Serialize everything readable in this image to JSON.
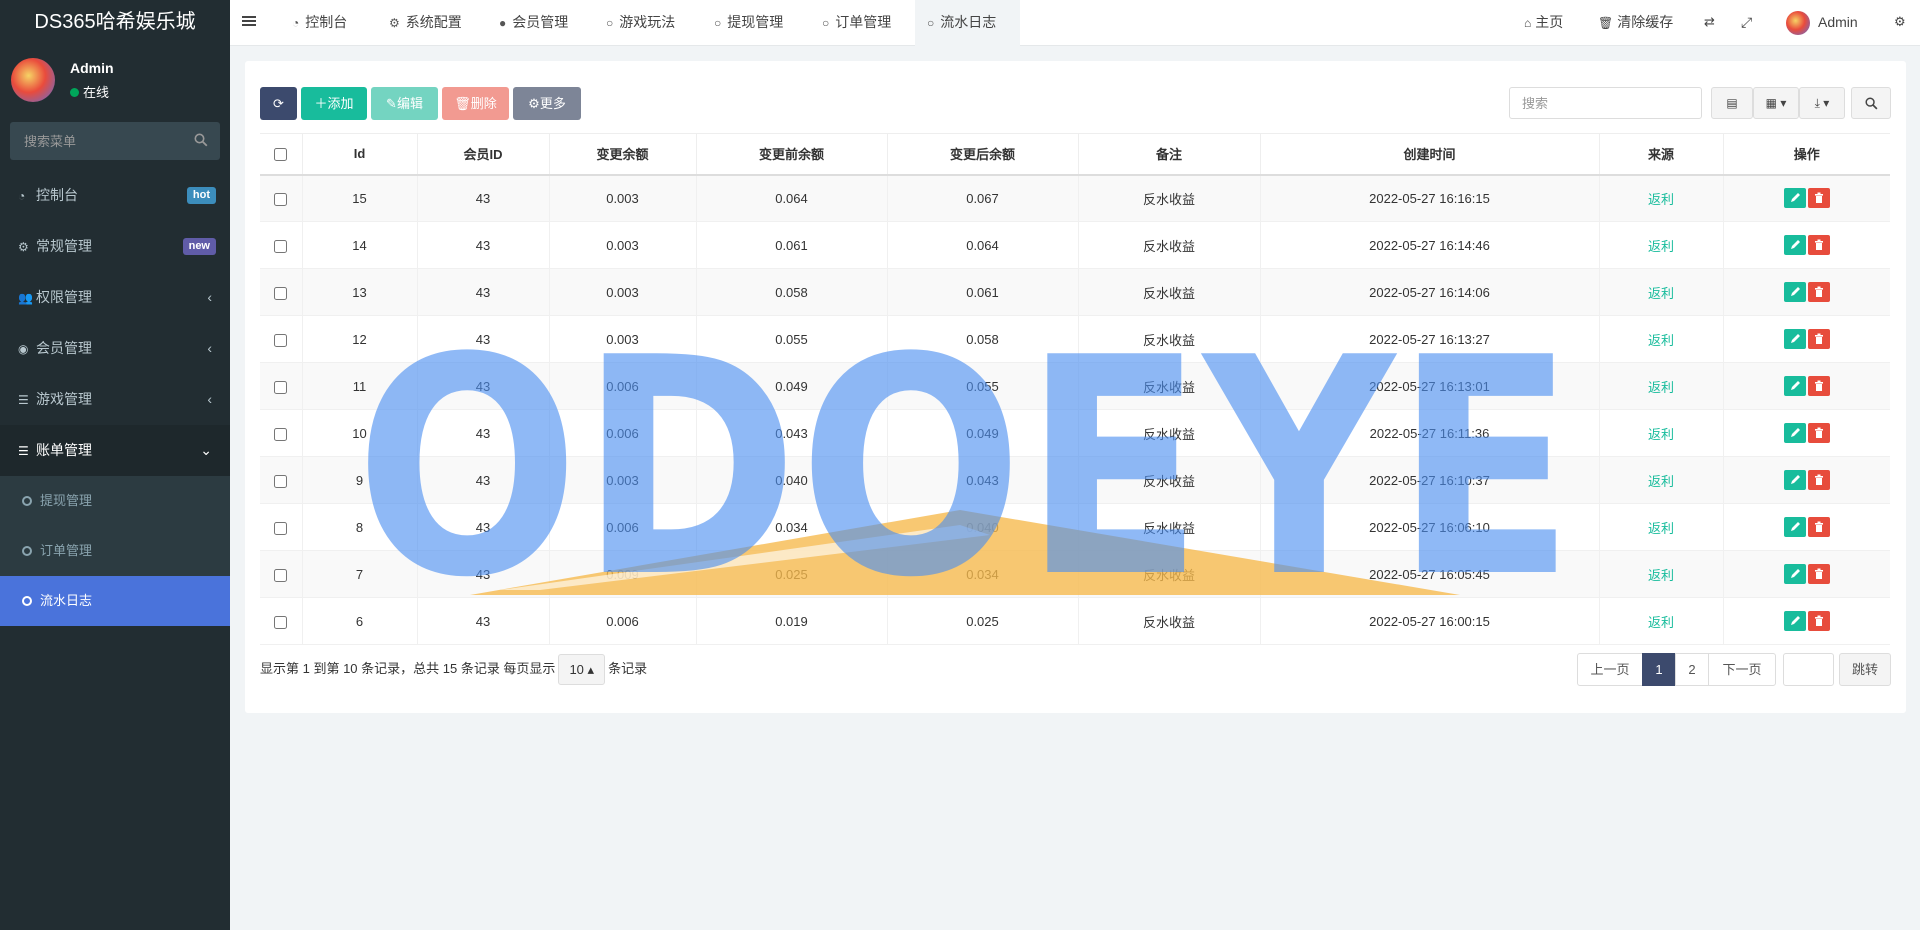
{
  "sidebar": {
    "logo": "DS365哈希娱乐城",
    "user": {
      "name": "Admin",
      "status": "在线"
    },
    "search_placeholder": "搜索菜单",
    "items": [
      {
        "label": "控制台",
        "badge": "hot",
        "badge_color": "#3c8dbc",
        "icon": "dashboard-icon"
      },
      {
        "label": "常规管理",
        "badge": "new",
        "badge_color": "#605ca8",
        "icon": "cogs-icon"
      },
      {
        "label": "权限管理",
        "icon": "users-icon"
      },
      {
        "label": "会员管理",
        "icon": "user-circle-icon"
      },
      {
        "label": "游戏管理",
        "icon": "list-icon"
      },
      {
        "label": "账单管理",
        "icon": "list-icon"
      }
    ],
    "subitems": [
      {
        "label": "提现管理"
      },
      {
        "label": "订单管理"
      },
      {
        "label": "流水日志"
      }
    ]
  },
  "topbar": {
    "tabs": [
      {
        "label": "控制台",
        "icon": "dashboard-icon"
      },
      {
        "label": "系统配置",
        "icon": "gear-icon"
      },
      {
        "label": "会员管理",
        "icon": "user-icon"
      },
      {
        "label": "游戏玩法",
        "icon": "circle-icon"
      },
      {
        "label": "提现管理",
        "icon": "circle-icon"
      },
      {
        "label": "订单管理",
        "icon": "circle-icon"
      },
      {
        "label": "流水日志",
        "icon": "circle-icon"
      }
    ],
    "home": "主页",
    "clear_cache": "清除缓存",
    "admin": "Admin"
  },
  "toolbar": {
    "add": "添加",
    "edit": "编辑",
    "delete": "删除",
    "more": "更多",
    "search_placeholder": "搜索"
  },
  "table": {
    "headers": [
      "Id",
      "会员ID",
      "变更余额",
      "变更前余额",
      "变更后余额",
      "备注",
      "创建时间",
      "来源",
      "操作"
    ],
    "rows": [
      [
        "15",
        "43",
        "0.003",
        "0.064",
        "0.067",
        "反水收益",
        "2022-05-27 16:16:15",
        "返利"
      ],
      [
        "14",
        "43",
        "0.003",
        "0.061",
        "0.064",
        "反水收益",
        "2022-05-27 16:14:46",
        "返利"
      ],
      [
        "13",
        "43",
        "0.003",
        "0.058",
        "0.061",
        "反水收益",
        "2022-05-27 16:14:06",
        "返利"
      ],
      [
        "12",
        "43",
        "0.003",
        "0.055",
        "0.058",
        "反水收益",
        "2022-05-27 16:13:27",
        "返利"
      ],
      [
        "11",
        "43",
        "0.006",
        "0.049",
        "0.055",
        "反水收益",
        "2022-05-27 16:13:01",
        "返利"
      ],
      [
        "10",
        "43",
        "0.006",
        "0.043",
        "0.049",
        "反水收益",
        "2022-05-27 16:11:36",
        "返利"
      ],
      [
        "9",
        "43",
        "0.003",
        "0.040",
        "0.043",
        "反水收益",
        "2022-05-27 16:10:37",
        "返利"
      ],
      [
        "8",
        "43",
        "0.006",
        "0.034",
        "0.040",
        "反水收益",
        "2022-05-27 16:06:10",
        "返利"
      ],
      [
        "7",
        "43",
        "0.009",
        "0.025",
        "0.034",
        "反水收益",
        "2022-05-27 16:05:45",
        "返利"
      ],
      [
        "6",
        "43",
        "0.006",
        "0.019",
        "0.025",
        "反水收益",
        "2022-05-27 16:00:15",
        "返利"
      ]
    ]
  },
  "pagination": {
    "info_prefix": "显示第 1 到第 10 条记录，总共 15 条记录 每页显示",
    "page_size": "10",
    "info_suffix": "条记录",
    "prev": "上一页",
    "pages": [
      "1",
      "2"
    ],
    "next": "下一页",
    "jump": "跳转"
  },
  "watermark": "ODOEYE",
  "colors": {
    "accent_teal": "#18bc9c",
    "active_blue": "#4a73db",
    "danger": "#e74c3c",
    "sidebar_bg": "#222d32"
  }
}
